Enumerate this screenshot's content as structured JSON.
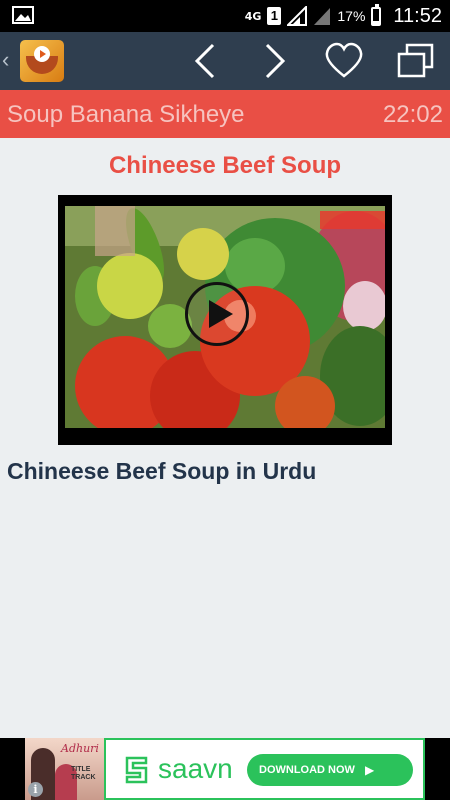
{
  "status_bar": {
    "network": "4G",
    "sim": "1",
    "battery": "17%",
    "time": "11:52"
  },
  "app_bar": {
    "icons": [
      "back-chevron-icon",
      "app-logo",
      "previous-icon",
      "next-icon",
      "favorite-icon",
      "copy-icon"
    ]
  },
  "header": {
    "title": "Soup Banana Sikheye",
    "time": "22:02"
  },
  "content": {
    "recipe_title": "Chineese Beef Soup",
    "video_caption": "Chineese Beef Soup in Urdu"
  },
  "ad": {
    "tagline": "Adhuri",
    "subtitle_line1": "TITLE",
    "subtitle_line2": "TRACK",
    "brand": "saavn",
    "cta": "DOWNLOAD NOW",
    "info": "i"
  },
  "colors": {
    "app_bar": "#2f3e4f",
    "accent": "#e94f45",
    "caption": "#23344a",
    "saavn_green": "#2bc25b"
  }
}
